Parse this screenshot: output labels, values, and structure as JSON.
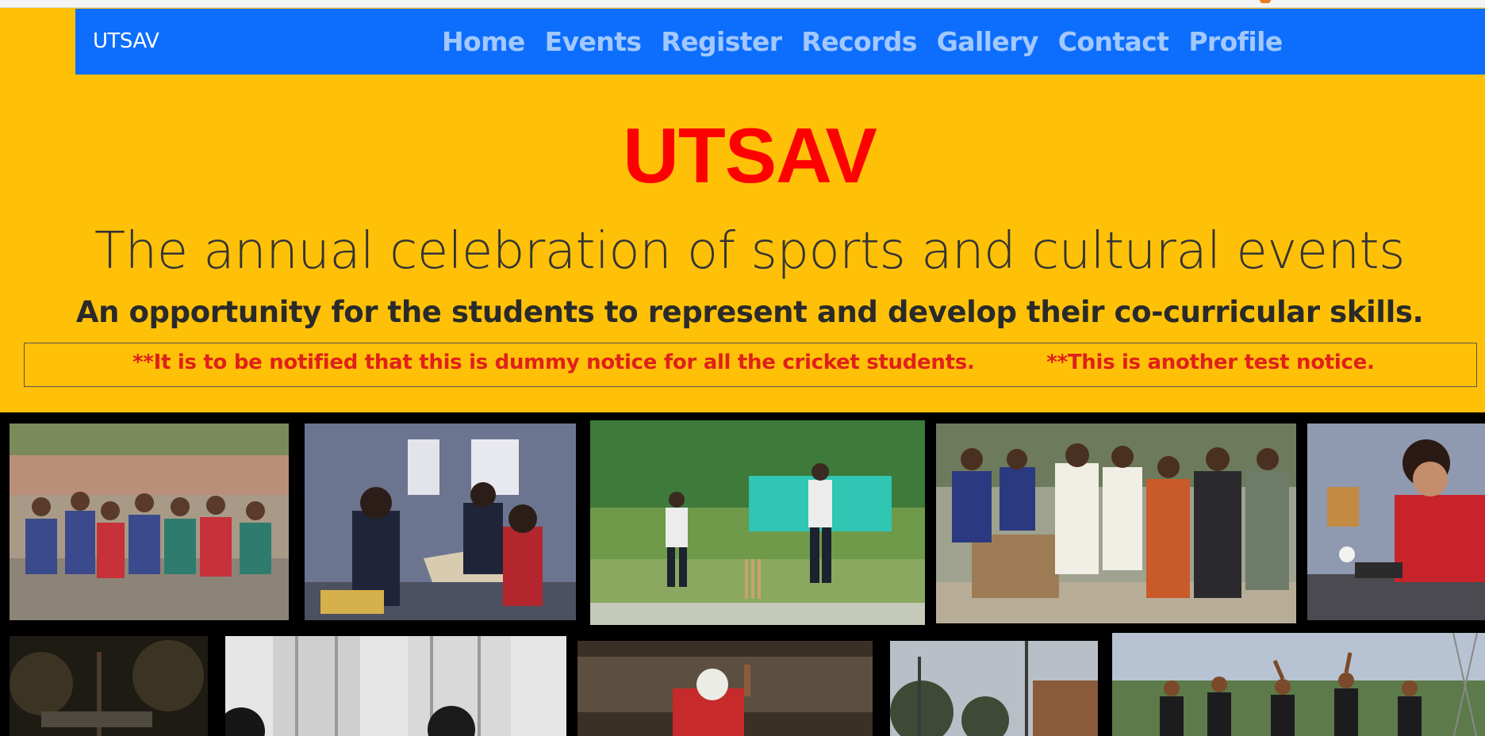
{
  "navbar": {
    "brand": "UTSAV",
    "links": [
      {
        "label": "Home"
      },
      {
        "label": "Events"
      },
      {
        "label": "Register"
      },
      {
        "label": "Records"
      },
      {
        "label": "Gallery"
      },
      {
        "label": "Contact"
      },
      {
        "label": "Profile"
      }
    ]
  },
  "hero": {
    "title": "UTSAV",
    "subtitle": "The annual celebration of sports and cultural events",
    "lead": "An opportunity for the students to represent and develop their co-curricular skills."
  },
  "notices": [
    "**It is to be notified that this is dummy notice for all the cricket students.",
    "**This is another test notice."
  ],
  "colors": {
    "page_background": "#ffc107",
    "navbar": "#0d6efd",
    "title": "#ff0000",
    "notice_text": "#e0201b",
    "gallery_background": "#000000"
  }
}
